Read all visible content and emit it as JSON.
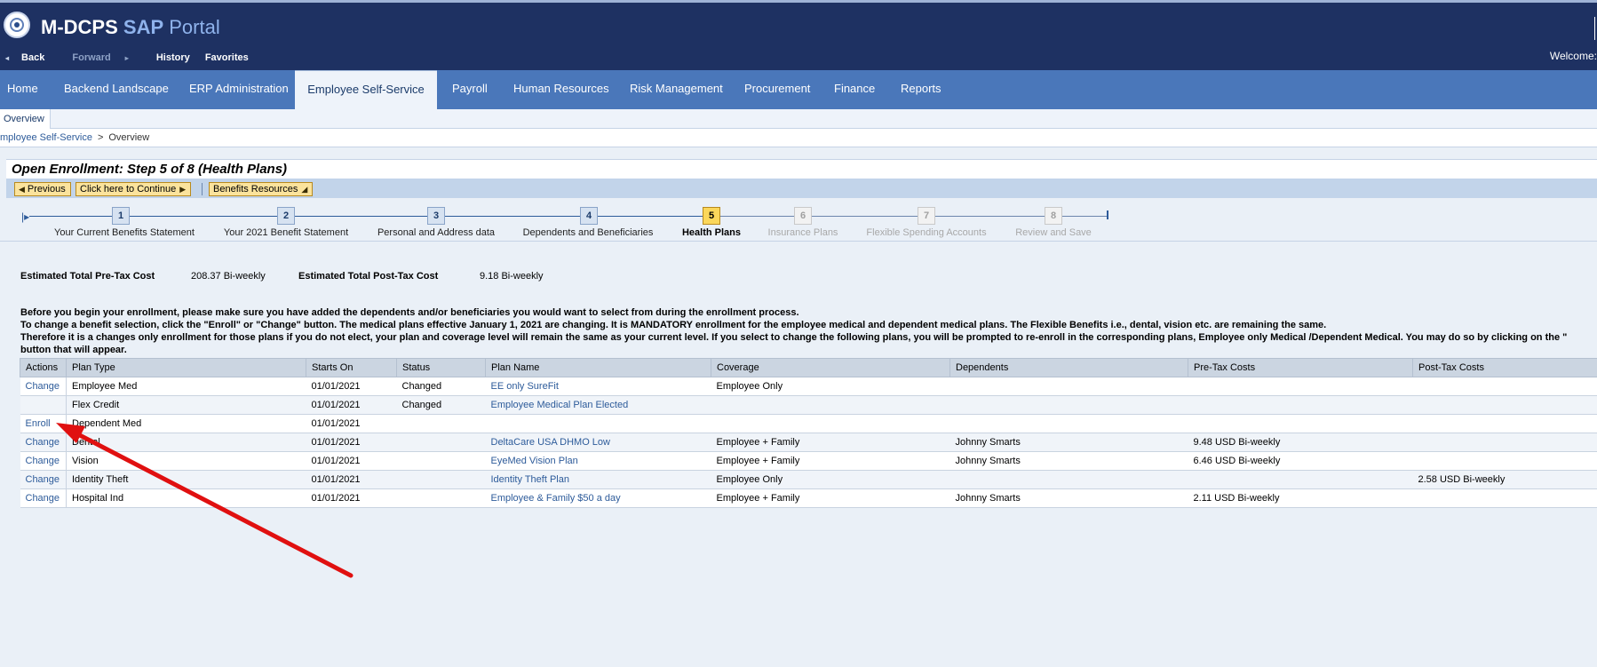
{
  "header": {
    "title_part1": "M-DCPS ",
    "title_part2": "SAP",
    "title_part3": " Portal",
    "back": "Back",
    "forward": "Forward",
    "history": "History",
    "favorites": "Favorites",
    "welcome": "Welcome:"
  },
  "topnav": {
    "tabs": [
      "Home",
      "Backend Landscape",
      "ERP Administration",
      "Employee Self-Service",
      "Payroll",
      "Human Resources",
      "Risk Management",
      "Procurement",
      "Finance",
      "Reports"
    ],
    "active": "Employee Self-Service"
  },
  "subnav": {
    "tab": "Overview"
  },
  "breadcrumb": {
    "item1": "mployee Self-Service",
    "sep": ">",
    "item2": "Overview"
  },
  "page": {
    "title": "Open Enrollment: Step 5  of 8  (Health Plans)",
    "previous_label": "Previous",
    "continue_label": "Click here to Continue",
    "resources_label": "Benefits Resources"
  },
  "roadmap": {
    "steps": [
      {
        "num": "1",
        "label": "Your Current Benefits Statement",
        "state": "done"
      },
      {
        "num": "2",
        "label": "Your 2021 Benefit Statement",
        "state": "done"
      },
      {
        "num": "3",
        "label": "Personal and Address data",
        "state": "done"
      },
      {
        "num": "4",
        "label": "Dependents and Beneficiaries",
        "state": "done"
      },
      {
        "num": "5",
        "label": "Health Plans",
        "state": "current"
      },
      {
        "num": "6",
        "label": "Insurance Plans",
        "state": "disabled"
      },
      {
        "num": "7",
        "label": "Flexible Spending Accounts",
        "state": "disabled"
      },
      {
        "num": "8",
        "label": "Review and Save",
        "state": "disabled"
      }
    ]
  },
  "costs": {
    "pretax_label": "Estimated Total Pre-Tax Cost",
    "pretax_value": "208.37  Bi-weekly",
    "posttax_label": "Estimated Total Post-Tax Cost",
    "posttax_value": "9.18  Bi-weekly"
  },
  "instructions": {
    "line1": "Before you begin your enrollment, please make sure you have added the dependents and/or beneficiaries you would want to select from during the enrollment process.",
    "line2": "To change a benefit selection, click the \"Enroll\" or \"Change\" button. The medical plans effective January 1, 2021 are changing. It is MANDATORY enrollment for the employee medical and dependent medical plans. The Flexible Benefits i.e., dental, vision etc. are remaining the same.",
    "line3": "Therefore it is a changes only enrollment for those plans if you do not elect, your plan and coverage level will remain the same as your current level. If you select to change the following plans, you will be prompted to re-enroll in the corresponding plans, Employee only Medical /Dependent Medical. You may do so by clicking on the \"",
    "line4": "button that will appear."
  },
  "table": {
    "headers": [
      "Actions",
      "Plan Type",
      "Starts On",
      "Status",
      "Plan Name",
      "Coverage",
      "Dependents",
      "Pre-Tax Costs",
      "Post-Tax Costs"
    ],
    "rows": [
      {
        "action": "Change",
        "plan_type": "Employee Med",
        "starts_on": "01/01/2021",
        "status": "Changed",
        "plan_name": "EE only SureFit",
        "coverage": "Employee Only",
        "dependents": "",
        "pretax": "",
        "posttax": ""
      },
      {
        "action": "",
        "plan_type": "Flex Credit",
        "starts_on": "01/01/2021",
        "status": "Changed",
        "plan_name": "Employee Medical Plan Elected",
        "coverage": "",
        "dependents": "",
        "pretax": "",
        "posttax": ""
      },
      {
        "action": "Enroll",
        "plan_type": "Dependent Med",
        "starts_on": "01/01/2021",
        "status": "",
        "plan_name": "",
        "coverage": "",
        "dependents": "",
        "pretax": "",
        "posttax": ""
      },
      {
        "action": "Change",
        "plan_type": "Dental",
        "starts_on": "01/01/2021",
        "status": "",
        "plan_name": "DeltaCare USA DHMO Low",
        "coverage": "Employee + Family",
        "dependents": "Johnny Smarts",
        "pretax": "9.48 USD Bi-weekly",
        "posttax": ""
      },
      {
        "action": "Change",
        "plan_type": "Vision",
        "starts_on": "01/01/2021",
        "status": "",
        "plan_name": "EyeMed Vision Plan",
        "coverage": "Employee + Family",
        "dependents": "Johnny Smarts",
        "pretax": "6.46 USD Bi-weekly",
        "posttax": ""
      },
      {
        "action": "Change",
        "plan_type": "Identity Theft",
        "starts_on": "01/01/2021",
        "status": "",
        "plan_name": "Identity Theft Plan",
        "coverage": "Employee Only",
        "dependents": "",
        "pretax": "",
        "posttax": "2.58 USD Bi-weekly"
      },
      {
        "action": "Change",
        "plan_type": "Hospital Ind",
        "starts_on": "01/01/2021",
        "status": "",
        "plan_name": "Employee & Family $50 a day",
        "coverage": "Employee + Family",
        "dependents": "Johnny Smarts",
        "pretax": "2.11 USD Bi-weekly",
        "posttax": ""
      }
    ]
  },
  "colors": {
    "header_bg": "#1e3162",
    "nav_bg": "#4a77ba",
    "annotation_arrow": "#e01010",
    "button_bg": "#fbe39c",
    "current_step": "#fbd75b"
  }
}
